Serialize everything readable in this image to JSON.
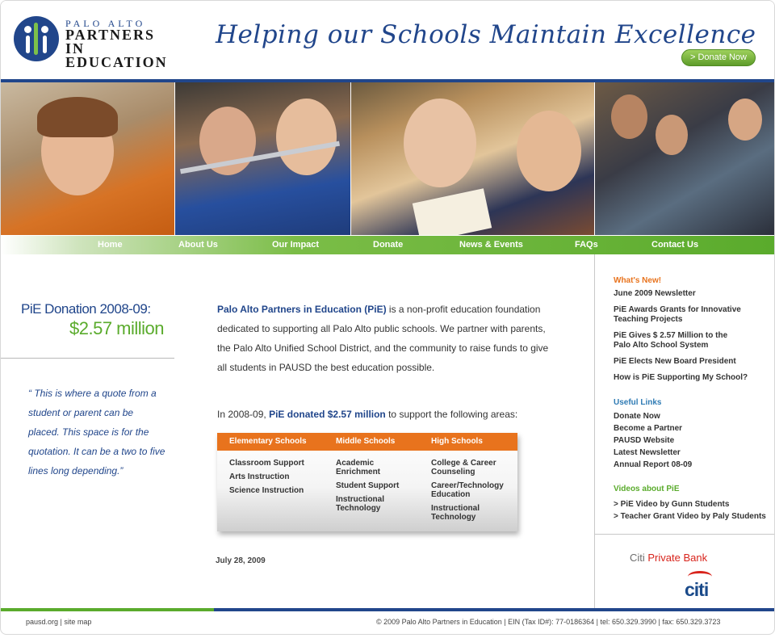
{
  "header": {
    "logo_small": "PALO ALTO",
    "logo_line1": "PARTNERS",
    "logo_line2": "IN EDUCATION",
    "tagline": "Helping our Schools Maintain Excellence",
    "donate_button": "> Donate Now"
  },
  "nav": [
    "Home",
    "About Us",
    "Our Impact",
    "Donate",
    "News & Events",
    "FAQs",
    "Contact Us"
  ],
  "left": {
    "donation_label": "PiE Donation 2008-09:",
    "donation_amount": "$2.57 million",
    "quote": "“ This is where a quote from a student or parent can be placed. This space is for the quotation. It can be a two to five lines long depending.”"
  },
  "main": {
    "intro_org": "Palo Alto Partners in Education (PiE)",
    "intro_rest": " is a non-profit education foundation dedicated to supporting all Palo Alto public schools. We partner with parents, the Palo Alto Unified School District, and the community to raise funds to give all students in PAUSD the best education possible.",
    "lead_prefix": "In 2008-09, ",
    "lead_highlight": "PiE donated $2.57 million",
    "lead_suffix": " to support the following areas:",
    "table": {
      "headers": [
        "Elementary Schools",
        "Middle Schools",
        "High Schools"
      ],
      "columns": [
        [
          "Classroom Support",
          "Arts Instruction",
          "Science Instruction"
        ],
        [
          "Academic Enrichment",
          "Student Support",
          "Instructional Technology"
        ],
        [
          "College & Career Counseling",
          "Career/Technology Education",
          "Instructional Technology"
        ]
      ]
    },
    "date": "July 28, 2009"
  },
  "sidebar": {
    "whats_new_title": "What's New!",
    "whats_new": [
      "June 2009 Newsletter",
      "PiE Awards Grants for Innovative Teaching Projects",
      "PiE Gives $ 2.57 Million to the Palo Alto School System",
      "PiE Elects New Board President",
      "How is PiE Supporting My School?"
    ],
    "useful_title": "Useful Links",
    "useful": [
      "Donate Now",
      "Become a Partner",
      "PAUSD Website",
      "Latest Newsletter",
      "Annual Report 08-09"
    ],
    "videos_title": "Videos about PiE",
    "videos": [
      "> PiE Video by Gunn Students",
      "> Teacher Grant Video by Paly Students"
    ],
    "sponsor_prefix": "Citi ",
    "sponsor_name": "Private Bank",
    "sponsor_logo": "citi"
  },
  "footer": {
    "left": "pausd.org | site map",
    "right": "© 2009 Palo Alto Partners in Education | EIN (Tax ID#): 77-0186364 | tel: 650.329.3990 | fax: 650.329.3723"
  },
  "colors": {
    "brand_blue": "#21468b",
    "brand_green": "#5aab2c",
    "accent_orange": "#e8731d",
    "sponsor_red": "#d8241c"
  }
}
